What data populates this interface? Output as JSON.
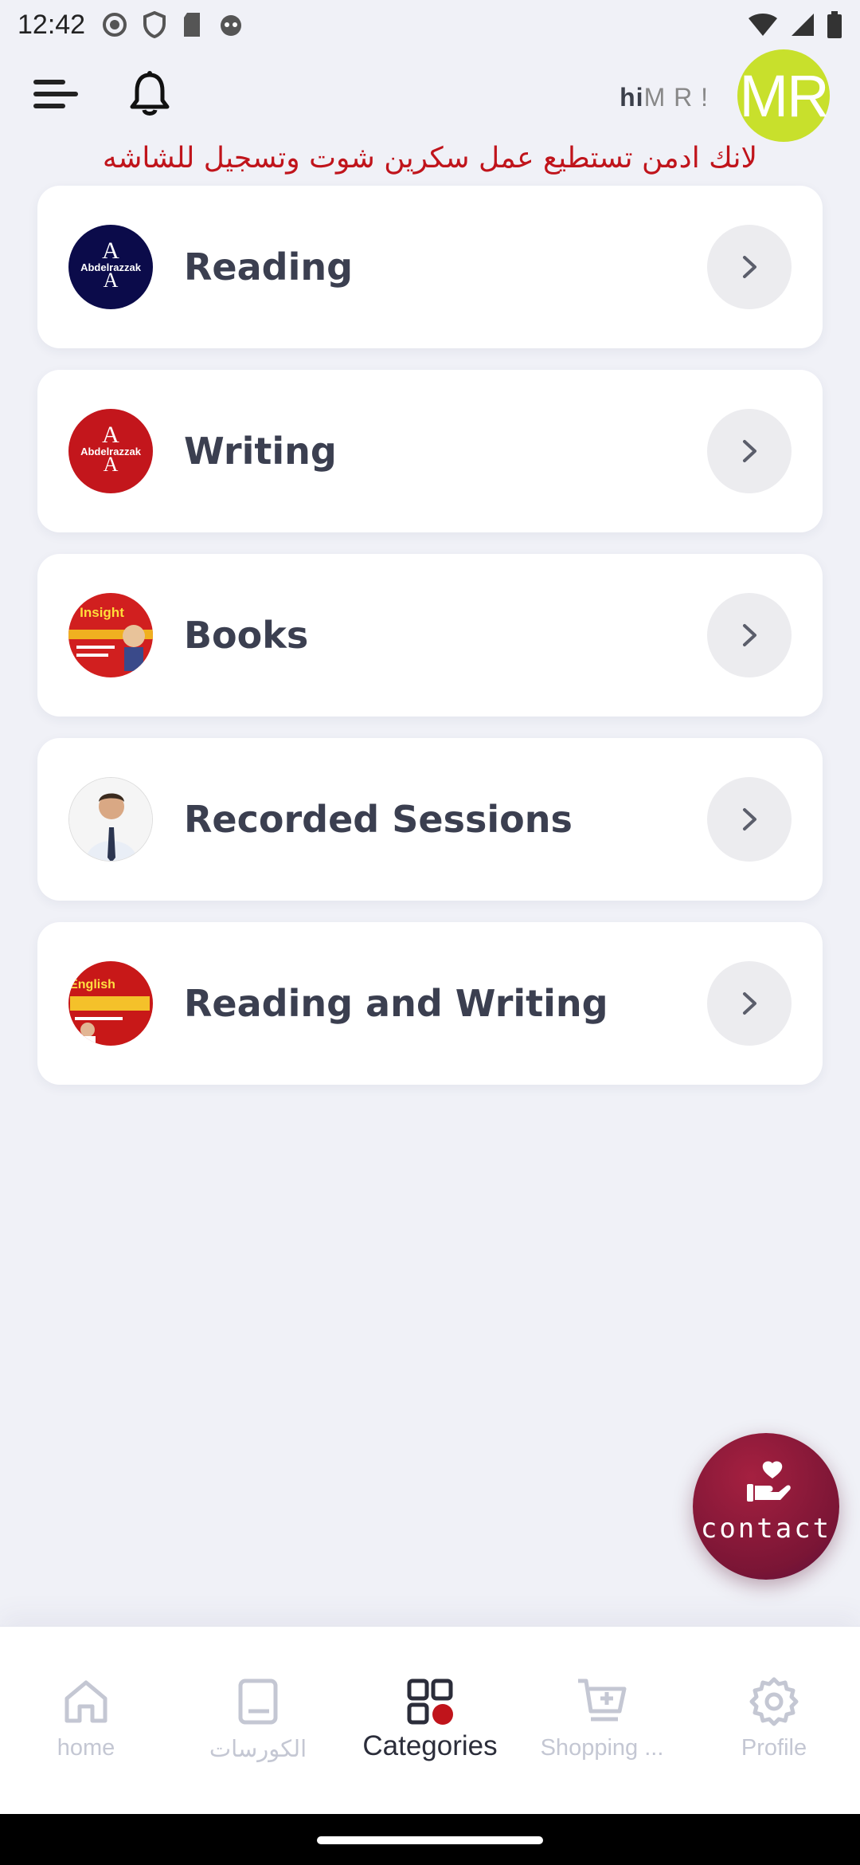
{
  "status_bar": {
    "time": "12:42",
    "left_icons": [
      "record-icon",
      "shield-icon",
      "sd-card-icon",
      "cat-face-icon"
    ],
    "right_icons": [
      "wifi-icon",
      "signal-icon",
      "battery-icon"
    ]
  },
  "header": {
    "greeting_prefix": "hi",
    "greeting_name": "M R !",
    "avatar_initials": "MR",
    "avatar_color": "#c8e02c"
  },
  "notice": "لانك ادمن تستطيع عمل سكرين شوت وتسجيل للشاشه",
  "categories": [
    {
      "label": "Reading",
      "thumb_text": "Abdelrazzak",
      "thumb_bg": "#0b0b4a"
    },
    {
      "label": "Writing",
      "thumb_text": "Abdelrazzak",
      "thumb_bg": "#c3161c"
    },
    {
      "label": "Books",
      "thumb_text": "Insight",
      "thumb_bg": "#d11f1f"
    },
    {
      "label": "Recorded Sessions",
      "thumb_text": "",
      "thumb_bg": "#f3f3f3"
    },
    {
      "label": "Reading and Writing",
      "thumb_text": "English",
      "thumb_bg": "#c81818"
    }
  ],
  "fab": {
    "label": "contact"
  },
  "bottom_nav": {
    "items": [
      {
        "label": "home",
        "icon": "home-icon",
        "active": false
      },
      {
        "label": "الكورسات",
        "icon": "book-icon",
        "active": false
      },
      {
        "label": "Categories",
        "icon": "categories-grid-icon",
        "active": true
      },
      {
        "label": "Shopping ...",
        "icon": "cart-icon",
        "active": false
      },
      {
        "label": "Profile",
        "icon": "gear-icon",
        "active": false
      }
    ]
  },
  "colors": {
    "accent": "#c0141b",
    "background": "#f0f1f7",
    "fab": "#7a1535",
    "inactive_nav": "#c4c7d3"
  }
}
